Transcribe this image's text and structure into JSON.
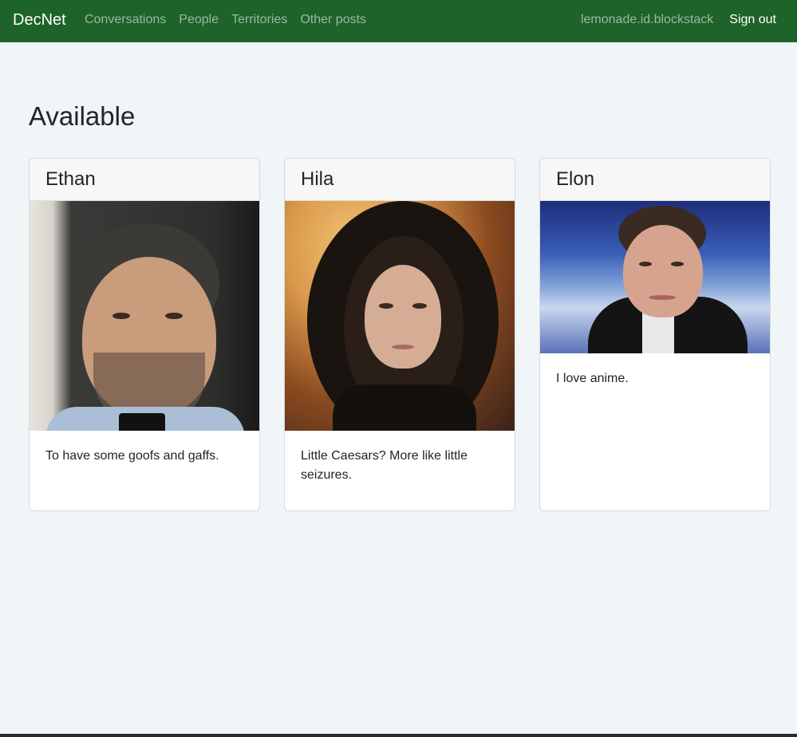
{
  "navbar": {
    "brand": "DecNet",
    "links": [
      "Conversations",
      "People",
      "Territories",
      "Other posts"
    ],
    "user": "lemonade.id.blockstack",
    "signout": "Sign out"
  },
  "page": {
    "title": "Available"
  },
  "cards": [
    {
      "name": "Ethan",
      "text": "To have some goofs and gaffs."
    },
    {
      "name": "Hila",
      "text": "Little Caesars? More like little seizures."
    },
    {
      "name": "Elon",
      "text": "I love anime."
    }
  ],
  "colors": {
    "navbar_bg": "#1e6329",
    "page_bg": "#f0f5f8",
    "card_header_bg": "#f7f7f7"
  }
}
